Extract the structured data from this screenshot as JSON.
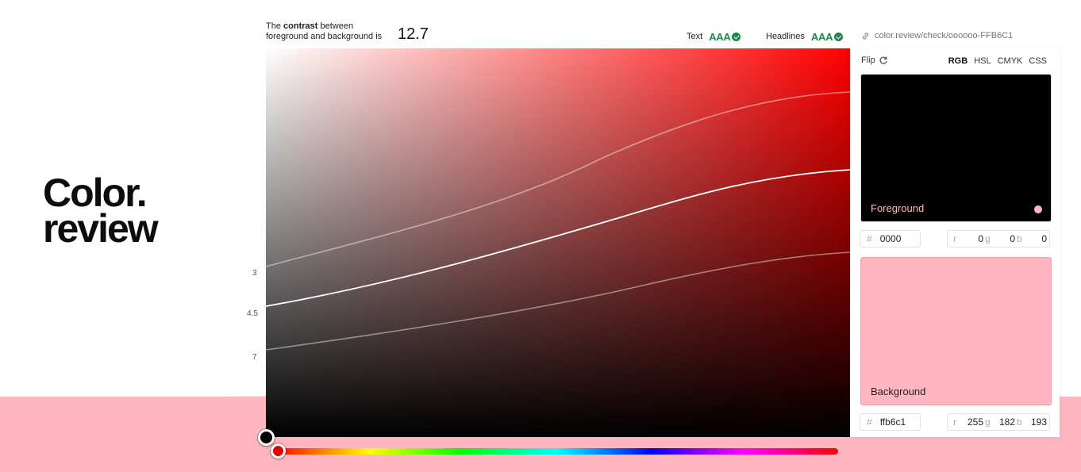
{
  "logo": {
    "line1": "Color.",
    "line2": "review"
  },
  "contrast": {
    "prefix": "The",
    "bold": "contrast",
    "suffix": "between foreground and background is",
    "value": "12.7"
  },
  "ratings": {
    "text": {
      "label": "Text",
      "grade": "AAA"
    },
    "headlines": {
      "label": "Headlines",
      "grade": "AAA"
    }
  },
  "share_url": "color.review/check/oooooo-FFB6C1",
  "ratio_labels": [
    "3",
    "4.5",
    "7"
  ],
  "panel": {
    "flip_label": "Flip",
    "modes": [
      "RGB",
      "HSL",
      "CMYK",
      "CSS"
    ],
    "active_mode": "RGB",
    "foreground": {
      "label": "Foreground",
      "hex": "0000",
      "r_label": "r",
      "r": "0",
      "g_label": "g",
      "g": "0",
      "b_label": "b",
      "b": "0",
      "color": "#000000"
    },
    "background": {
      "label": "Background",
      "hex": "ffb6c1",
      "r_label": "r",
      "r": "255",
      "g_label": "g",
      "g": "182",
      "b_label": "b",
      "b": "193",
      "color": "#ffb6c1"
    }
  },
  "colors": {
    "accent_pass": "#1a8a4a",
    "brand_pink": "#ffb6c1",
    "hue": "#ff0000"
  }
}
